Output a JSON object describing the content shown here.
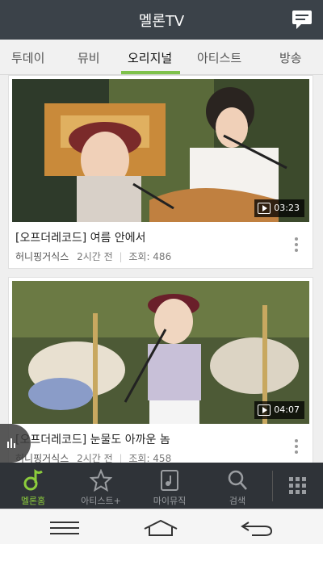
{
  "header": {
    "title": "멜론TV",
    "chat_icon": "chat-bubble-icon"
  },
  "tabs": [
    {
      "label": "투데이"
    },
    {
      "label": "뮤비"
    },
    {
      "label": "오리지널",
      "active": true
    },
    {
      "label": "아티스트"
    },
    {
      "label": "방송"
    }
  ],
  "videos": [
    {
      "title": "[오프더레코드] 여름 안에서",
      "channel": "허니핑거식스",
      "time_ago": "2시간 전",
      "views": "조회: 486",
      "duration": "03:23"
    },
    {
      "title": "[오프더레코드] 눈물도 아까운 놈",
      "channel": "허니핑거식스",
      "time_ago": "2시간 전",
      "views": "조회: 458",
      "duration": "04:07"
    }
  ],
  "bottom_nav": [
    {
      "label": "멜론홈",
      "icon": "melon-note-icon",
      "active": true
    },
    {
      "label": "아티스트+",
      "icon": "star-icon"
    },
    {
      "label": "마이뮤직",
      "icon": "music-file-icon"
    },
    {
      "label": "검색",
      "icon": "search-icon"
    },
    {
      "label": "",
      "icon": "grid-menu-icon"
    }
  ],
  "system_nav": [
    "menu-icon",
    "home-icon",
    "back-icon"
  ],
  "colors": {
    "accent": "#7ec24a",
    "header_bg": "#3b4249",
    "nav_bg": "#2f3338",
    "active_label": "#8ccc3c"
  }
}
